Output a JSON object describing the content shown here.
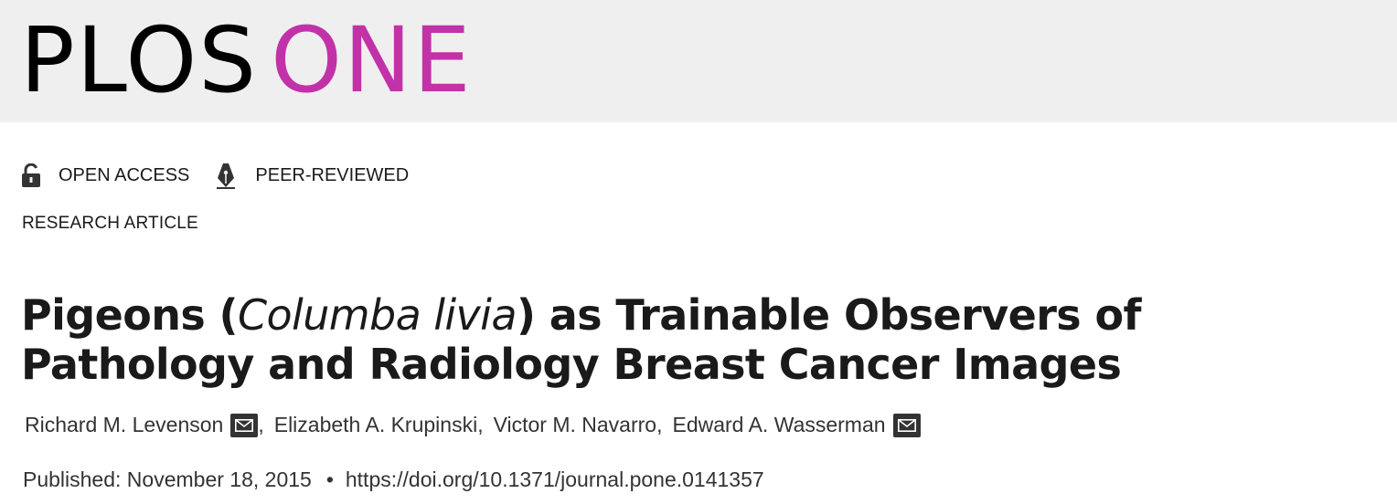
{
  "journal": {
    "brand_part1": "PLOS",
    "brand_part2": "ONE",
    "brand_accent_color": "#c132a8"
  },
  "badges": [
    {
      "icon": "unlocked-padlock-icon",
      "label": "OPEN ACCESS"
    },
    {
      "icon": "pen-nib-icon",
      "label": "PEER-REVIEWED"
    }
  ],
  "article_type": "RESEARCH ARTICLE",
  "title": {
    "part1": "Pigeons (",
    "italic": "Columba livia",
    "part2": ") as Trainable Observers of Pathology and Radiology Breast Cancer Images"
  },
  "authors": [
    {
      "name": "Richard M. Levenson",
      "separator": ",",
      "corresponding": true
    },
    {
      "name": "Elizabeth A. Krupinski",
      "separator": ",",
      "corresponding": false
    },
    {
      "name": "Victor M. Navarro",
      "separator": ",",
      "corresponding": false
    },
    {
      "name": "Edward A. Wasserman",
      "separator": "",
      "corresponding": true
    }
  ],
  "publication": {
    "published": "Published: November 18, 2015",
    "bullet": "•",
    "doi": "https://doi.org/10.1371/journal.pone.0141357"
  }
}
